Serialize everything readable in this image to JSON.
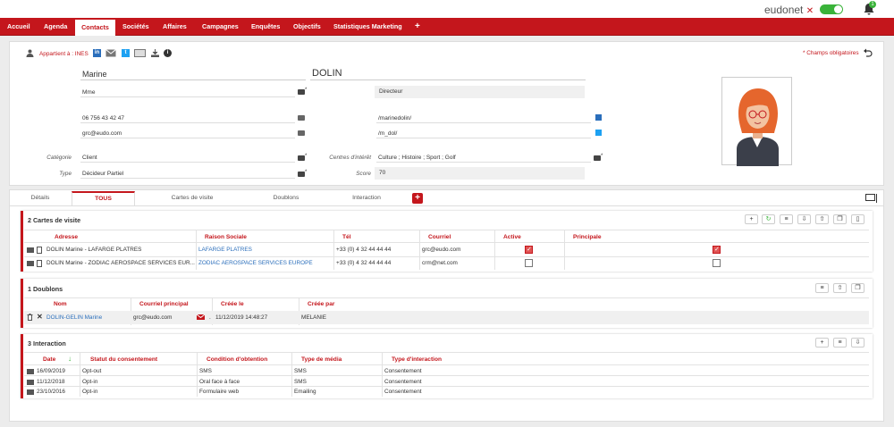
{
  "app": {
    "brand": "eudonet",
    "brand_mark": "✕",
    "notifications": "1"
  },
  "nav": [
    "Accueil",
    "Agenda",
    "Contacts",
    "Sociétés",
    "Affaires",
    "Campagnes",
    "Enquêtes",
    "Objectifs",
    "Statistiques Marketing",
    "+"
  ],
  "contact": {
    "owner_label": "Appartient à : INES",
    "required_note": "* Champs obligatoires",
    "firstname": "Marine",
    "lastname": "DOLIN",
    "civility": "Mme",
    "function": "Directeur",
    "phone": "06 756 43 42 47",
    "linkedin": "/marinedolin/",
    "email": "grc@eudo.com",
    "twitter": "/m_dol/",
    "category_label": "Catégorie",
    "category": "Client",
    "interests_label": "Centres d'intérêt",
    "interests": "Culture ; Histoire ; Sport ; Golf",
    "type_label": "Type",
    "type": "Décideur Partiel",
    "score_label": "Score",
    "score": "70",
    "star": "*"
  },
  "tabs": [
    "Détails",
    "TOUS",
    "Cartes de visite",
    "Doublons",
    "Interaction",
    "+"
  ],
  "cards": {
    "title": "2 Cartes de visite",
    "headers": [
      "Adresse",
      "Raison Sociale",
      "Tél",
      "Courriel",
      "Active",
      "Principale"
    ],
    "rows": [
      {
        "adresse": "DOLIN Marine - LAFARGE PLATRES",
        "raison": "LAFARGE PLATRES",
        "tel": "+33 (0) 4 32 44 44 44",
        "courriel": "grc@eudo.com",
        "active": true,
        "principale": true
      },
      {
        "adresse": "DOLIN Marine - ZODIAC AEROSPACE SERVICES EUR...",
        "raison": "ZODIAC AEROSPACE SERVICES EUROPE",
        "tel": "+33 (0) 4 32 44 44 44",
        "courriel": "crm@net.com",
        "active": false,
        "principale": false
      }
    ]
  },
  "doublons": {
    "title": "1 Doublons",
    "headers": [
      "Nom",
      "Courriel principal",
      "Créée le",
      "Créée par"
    ],
    "rows": [
      {
        "nom": "DOLIN-GELIN Marine",
        "courriel": "grc@eudo.com",
        "creee_le": "11/12/2019 14:48:27",
        "creee_par": "MELANIE",
        "prefix": "."
      }
    ]
  },
  "interaction": {
    "title": "3 Interaction",
    "headers": [
      "Date",
      "Statut du consentement",
      "Condition d'obtention",
      "Type de média",
      "Type d'interaction"
    ],
    "rows": [
      {
        "date": "16/09/2019",
        "statut": "Opt-out",
        "condition": "SMS",
        "media": "SMS",
        "type": "Consentement"
      },
      {
        "date": "11/12/2018",
        "statut": "Opt-in",
        "condition": "Oral face à face",
        "media": "SMS",
        "type": "Consentement"
      },
      {
        "date": "23/10/2016",
        "statut": "Opt-in",
        "condition": "Formulaire web",
        "media": "Emailing",
        "type": "Consentement"
      }
    ]
  },
  "colors": {
    "brand": "#c4161c",
    "link": "#2a6ebb",
    "toggle": "#3ab33a"
  }
}
